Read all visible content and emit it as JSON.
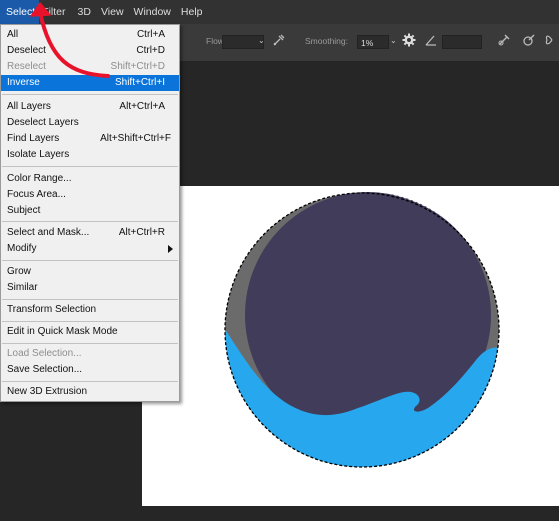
{
  "menubar": {
    "items": [
      {
        "label": "Select",
        "active": true
      },
      {
        "label": "Filter"
      },
      {
        "label": "3D"
      },
      {
        "label": "View"
      },
      {
        "label": "Window"
      },
      {
        "label": "Help"
      }
    ]
  },
  "options_bar": {
    "flow_label": "Flow:",
    "flow_value": "",
    "smoothing_label": "Smoothing:",
    "smoothing_value": "1%",
    "angle_value": ""
  },
  "select_menu": {
    "items": {
      "all": {
        "label": "All",
        "shortcut": "Ctrl+A"
      },
      "deselect": {
        "label": "Deselect",
        "shortcut": "Ctrl+D"
      },
      "reselect": {
        "label": "Reselect",
        "shortcut": "Shift+Ctrl+D"
      },
      "inverse": {
        "label": "Inverse",
        "shortcut": "Shift+Ctrl+I"
      },
      "all_layers": {
        "label": "All Layers",
        "shortcut": "Alt+Ctrl+A"
      },
      "deselect_layers": {
        "label": "Deselect Layers"
      },
      "find_layers": {
        "label": "Find Layers",
        "shortcut": "Alt+Shift+Ctrl+F"
      },
      "isolate_layers": {
        "label": "Isolate Layers"
      },
      "color_range": {
        "label": "Color Range..."
      },
      "focus_area": {
        "label": "Focus Area..."
      },
      "subject": {
        "label": "Subject"
      },
      "select_and_mask": {
        "label": "Select and Mask...",
        "shortcut": "Alt+Ctrl+R"
      },
      "modify": {
        "label": "Modify"
      },
      "grow": {
        "label": "Grow"
      },
      "similar": {
        "label": "Similar"
      },
      "transform_selection": {
        "label": "Transform Selection"
      },
      "quick_mask": {
        "label": "Edit in Quick Mask Mode"
      },
      "load_selection": {
        "label": "Load Selection..."
      },
      "save_selection": {
        "label": "Save Selection..."
      },
      "new_3d_extrusion": {
        "label": "New 3D Extrusion"
      }
    }
  },
  "colors": {
    "menubar_bg": "#323232",
    "options_bg": "#3a3a3a",
    "workspace_bg": "#262626",
    "menu_highlight": "#0a74da",
    "annotation_arrow": "#e8132a",
    "circle_outer_gray": "#6b6b6b",
    "circle_inner_purple": "#403c5a",
    "water_blue": "#27a8ee"
  },
  "icons": {
    "airbrush": "airbrush-icon",
    "settings": "gear-icon",
    "angle": "angle-icon",
    "pressure": "pressure-icon",
    "symmetry": "butterfly-icon",
    "annotation": "red-curved-arrow"
  }
}
